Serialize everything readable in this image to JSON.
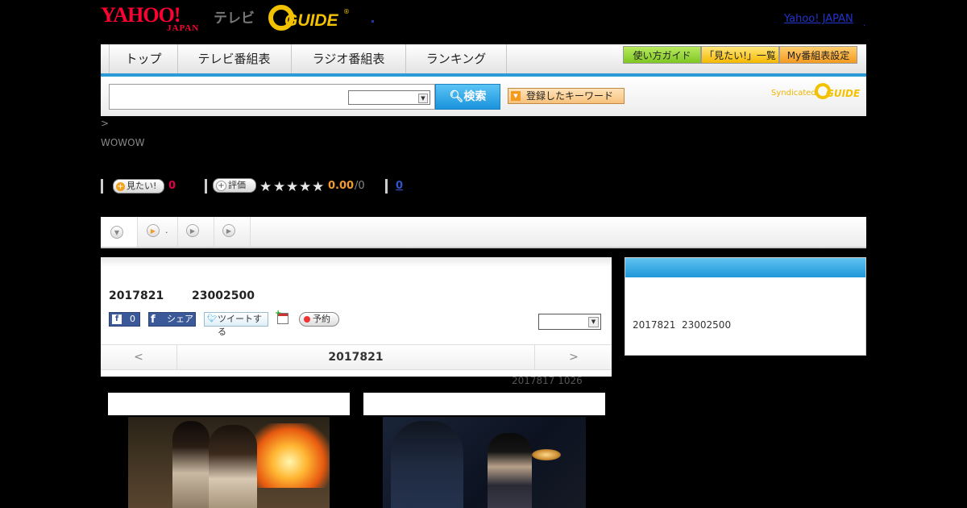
{
  "header": {
    "yahoo_logo_main": "YAHOO!",
    "yahoo_logo_sub": "JAPAN",
    "tv_label": "テレビ",
    "gguide_logo": "GUIDE",
    "gguide_reg": "®",
    "yahoo_japan_link": "Yahoo! JAPAN",
    "yahoo_japan_dot": "."
  },
  "nav": {
    "tabs": [
      {
        "label": "トップ"
      },
      {
        "label": "テレビ番組表"
      },
      {
        "label": "ラジオ番組表"
      },
      {
        "label": "ランキング"
      }
    ],
    "guide_button": "使い方ガイド",
    "mitai_list_button": "「見たい!」一覧",
    "my_table_button": "My番組表設定"
  },
  "search": {
    "input_value": "",
    "button_label": "検索",
    "keyword_button": "登録したキーワード",
    "syndicated": "Syndicated",
    "syndicated_logo": "GUIDE"
  },
  "breadcrumb": " > ",
  "channel": "WOWOW",
  "stats": {
    "mitai_label": "見たい!",
    "mitai_count": "0",
    "hyouka_label": "評価",
    "stars": [
      "★",
      "★",
      "★",
      "★",
      "★"
    ],
    "rating_score": "0.00",
    "rating_count": "/0",
    "review_count": "0"
  },
  "subtabs": {
    "tab2_label": "."
  },
  "program": {
    "date": "2017821",
    "time": "23002500",
    "fb_like_label": "f",
    "fb_like_count": "0",
    "fb_share_icon": "f",
    "fb_share_label": "シェア",
    "tweet_label": "ツイートする",
    "reserve_label": "予約",
    "date_nav_prev": "<",
    "date_nav_current": "2017821",
    "date_nav_next": ">"
  },
  "updated_note": "2017817  1026",
  "side_panel": {
    "date": "2017821",
    "time": "23002500"
  },
  "colors": {
    "accent_blue": "#2a9bd6",
    "yahoo_red": "#ff0033",
    "gguide_yellow": "#f2c200",
    "mitai_pink": "#e0004a",
    "rating_orange": "#f29b30"
  }
}
